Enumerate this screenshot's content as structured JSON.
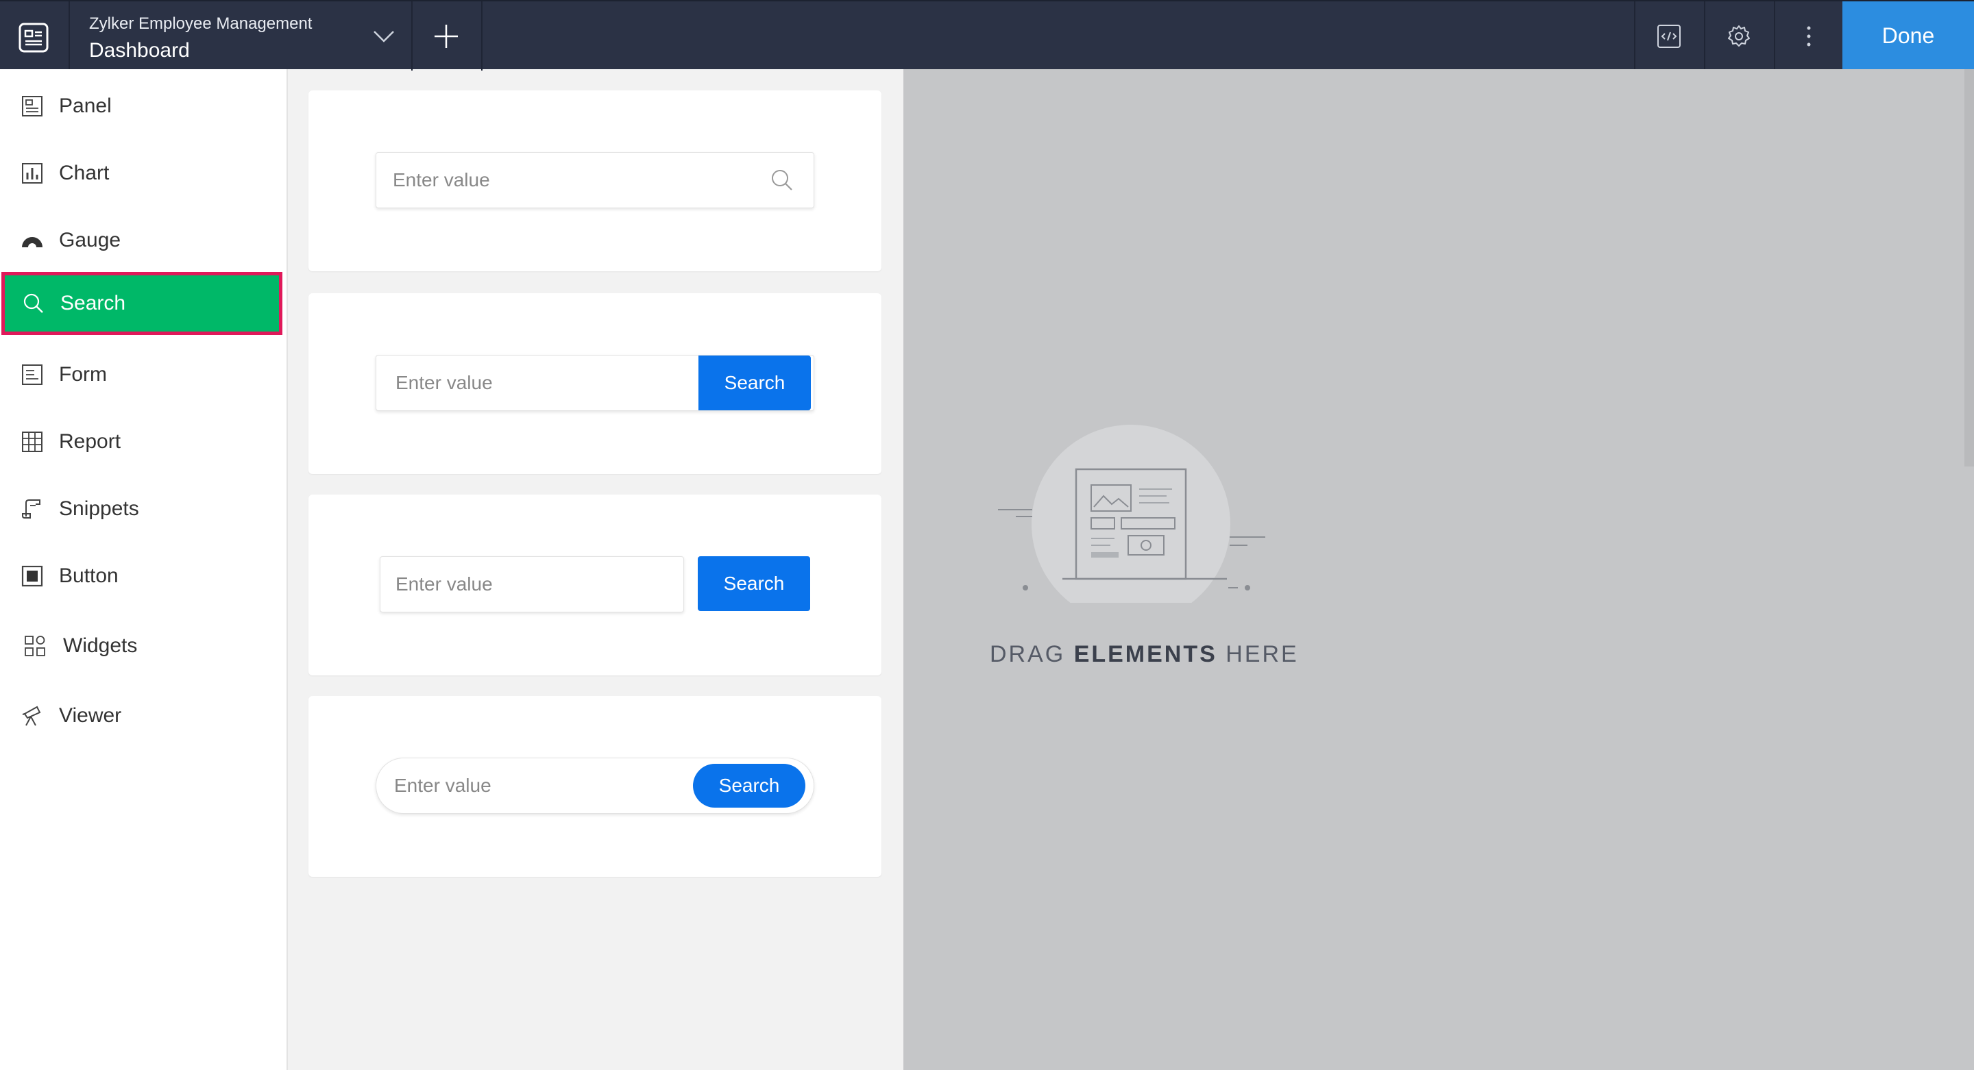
{
  "header": {
    "app_name": "Zylker Employee Management",
    "page_name": "Dashboard",
    "done_label": "Done"
  },
  "sidebar": {
    "items": [
      {
        "label": "Panel",
        "icon": "panel-icon"
      },
      {
        "label": "Chart",
        "icon": "chart-icon"
      },
      {
        "label": "Gauge",
        "icon": "gauge-icon"
      },
      {
        "label": "Search",
        "icon": "search-icon",
        "active": true
      },
      {
        "label": "Form",
        "icon": "form-icon"
      },
      {
        "label": "Report",
        "icon": "report-icon"
      },
      {
        "label": "Snippets",
        "icon": "snippets-icon"
      },
      {
        "label": "Button",
        "icon": "button-icon"
      },
      {
        "label": "Widgets",
        "icon": "widgets-icon"
      },
      {
        "label": "Viewer",
        "icon": "viewer-icon"
      }
    ]
  },
  "search_variants": [
    {
      "placeholder": "Enter value",
      "style": "icon"
    },
    {
      "placeholder": "Enter value",
      "button": "Search",
      "style": "attached-button"
    },
    {
      "placeholder": "Enter value",
      "button": "Search",
      "style": "separate-button"
    },
    {
      "placeholder": "Enter value",
      "button": "Search",
      "style": "pill"
    }
  ],
  "canvas": {
    "drop_prefix": "DRAG ",
    "drop_bold": "ELEMENTS",
    "drop_suffix": " HERE"
  },
  "colors": {
    "topbar": "#2b3245",
    "done": "#2c8de0",
    "active_item": "#00b868",
    "highlight_border": "#e0195a",
    "search_button": "#0a73eb",
    "canvas": "#c5c6c8"
  }
}
